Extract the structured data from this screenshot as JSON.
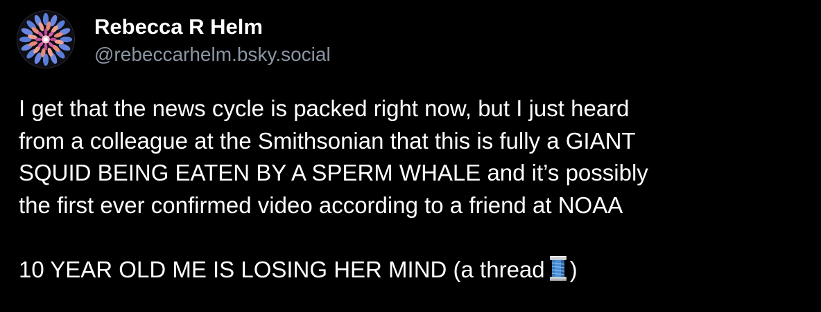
{
  "author": {
    "display_name": "Rebecca R Helm",
    "handle": "@rebeccarhelm.bsky.social",
    "avatar_icon": "jellyfish-avatar-icon"
  },
  "post": {
    "lines": [
      "I get that the news cycle is packed right now, but I just heard",
      "from a colleague at the Smithsonian that this is fully a GIANT",
      "SQUID BEING EATEN BY A SPERM WHALE and it’s possibly",
      "the first ever confirmed video according to a friend at NOAA"
    ],
    "final_line_before_emoji": "10 YEAR OLD ME IS LOSING HER MIND (a thread",
    "final_line_after_emoji": ")",
    "emoji": "spool-of-thread-icon"
  },
  "colors": {
    "background": "#000000",
    "text": "#ffffff",
    "handle": "#8b96a3"
  }
}
